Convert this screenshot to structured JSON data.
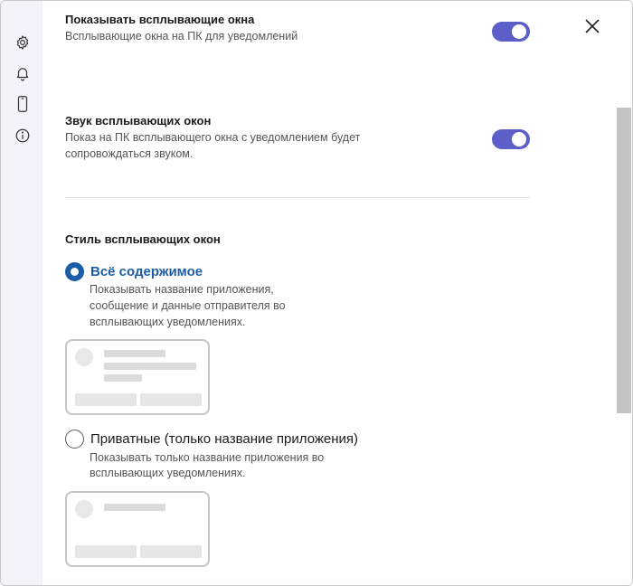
{
  "settings": {
    "show_popups": {
      "title": "Показывать всплывающие окна",
      "description": "Всплывающие окна на ПК для уведомлений",
      "enabled": true
    },
    "popup_sound": {
      "title": "Звук всплывающих окон",
      "description_line1": "Показ на ПК всплывающего окна с уведомлением будет",
      "description_line2": "сопровождаться звуком.",
      "enabled": true
    }
  },
  "popup_style": {
    "heading": "Стиль всплывающих окон",
    "options": [
      {
        "label": "Всё содержимое",
        "description_lines": [
          "Показывать название приложения,",
          "сообщение и данные отправителя во",
          "всплывающих уведомлениях."
        ],
        "selected": true
      },
      {
        "label": "Приватные (только название приложения)",
        "description_lines": [
          "Показывать только название приложения во",
          "всплывающих уведомлениях."
        ],
        "selected": false
      }
    ]
  },
  "nav": {
    "icons": [
      "gear-icon",
      "bell-icon",
      "phone-icon",
      "info-icon"
    ]
  },
  "colors": {
    "accent": "#5b5fc7",
    "selected_text": "#1c5da8",
    "rail_background": "#f1f4fb"
  }
}
